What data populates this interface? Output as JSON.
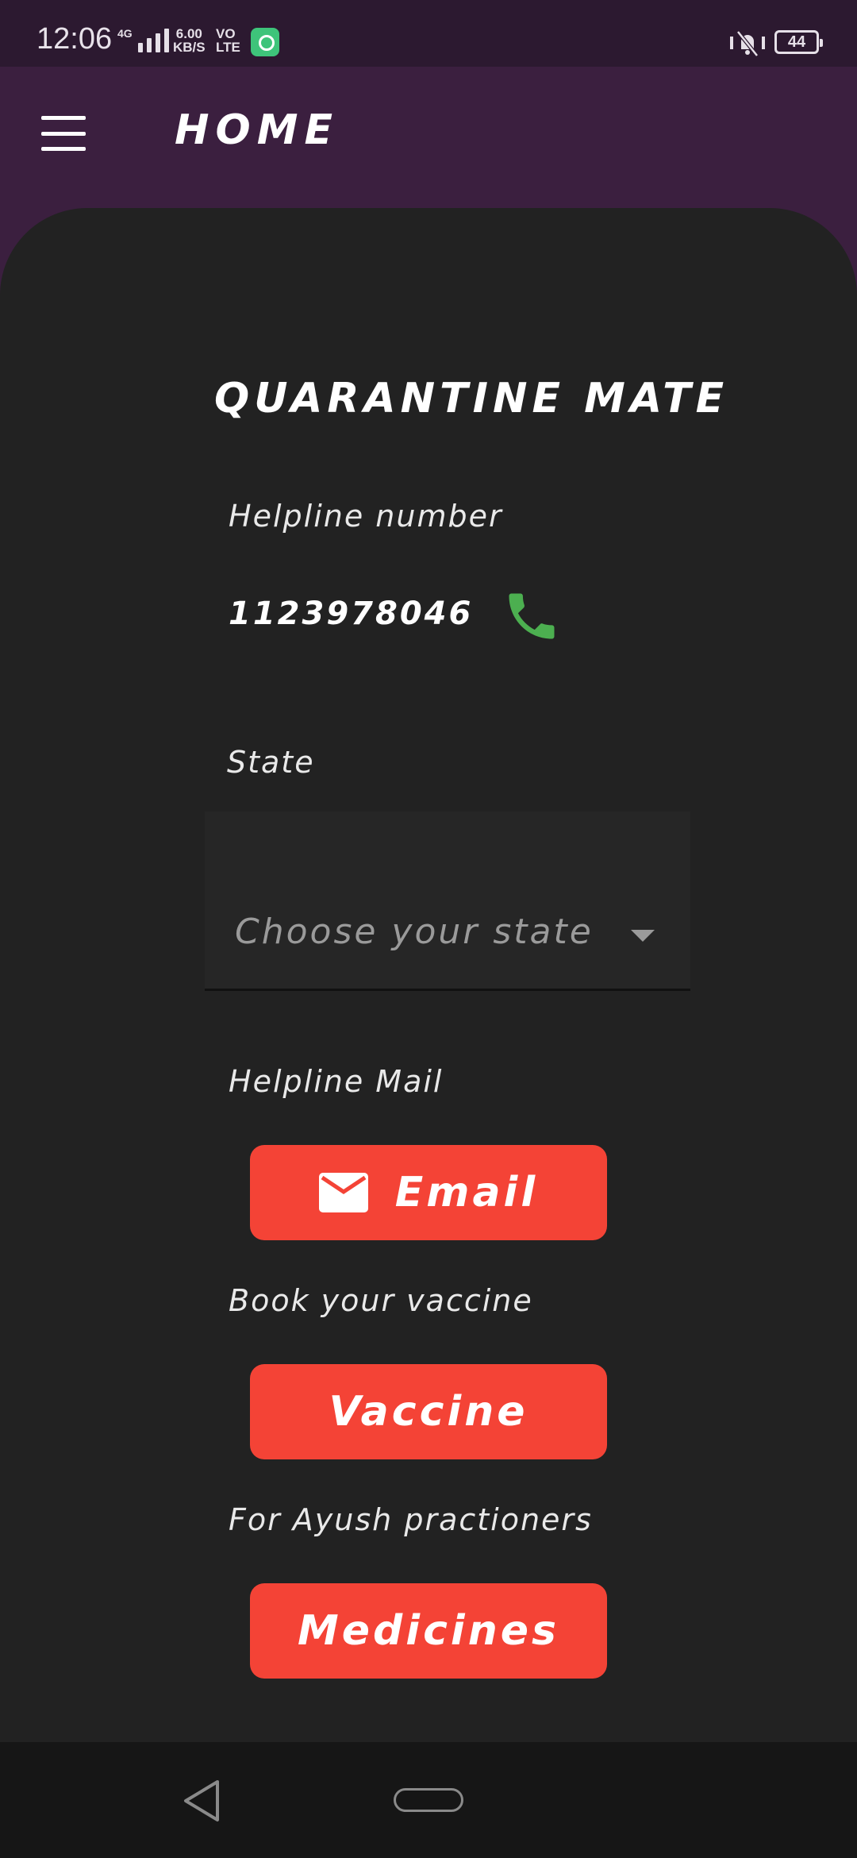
{
  "status_bar": {
    "time": "12:06",
    "network": "4G",
    "speed_value": "6.00",
    "speed_unit": "KB/S",
    "volte_top": "VO",
    "volte_bottom": "LTE",
    "battery": "44",
    "icons": [
      "signal-icon",
      "app-notification-icon",
      "mute-vibrate-icon",
      "battery-icon"
    ]
  },
  "app_bar": {
    "title": "HOME",
    "menu_icon": "hamburger-menu-icon",
    "background": "#3b1f3f"
  },
  "main": {
    "title": "QUARANTINE MATE",
    "helpline": {
      "label": "Helpline number",
      "number": "1123978046",
      "icon": "phone-icon",
      "icon_color": "#4caf50"
    },
    "state": {
      "label": "State",
      "placeholder": "Choose your state",
      "icon": "dropdown-caret-icon"
    },
    "mail": {
      "label": "Helpline Mail",
      "button_label": "Email",
      "icon": "mail-icon"
    },
    "vaccine": {
      "label": "Book your vaccine",
      "button_label": "Vaccine"
    },
    "ayush": {
      "label": "For Ayush practioners",
      "button_label": "Medicines"
    },
    "accent": "#f44336"
  },
  "nav_bar": {
    "icons": [
      "back-icon",
      "home-pill-icon"
    ]
  }
}
